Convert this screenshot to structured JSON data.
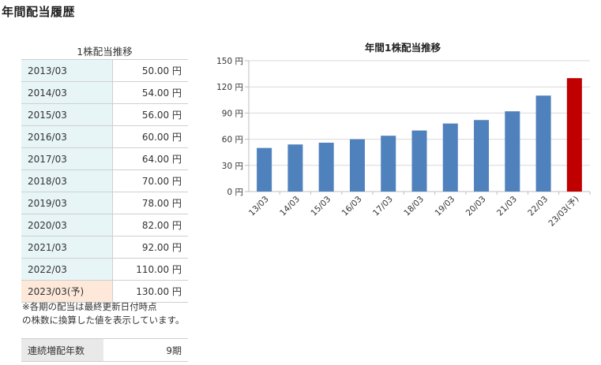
{
  "page": {
    "title": "年間配当履歴"
  },
  "history_table": {
    "caption": "1株配当推移",
    "rows": [
      {
        "period": "2013/03",
        "amount": "50.00 円"
      },
      {
        "period": "2014/03",
        "amount": "54.00 円"
      },
      {
        "period": "2015/03",
        "amount": "56.00 円"
      },
      {
        "period": "2016/03",
        "amount": "60.00 円"
      },
      {
        "period": "2017/03",
        "amount": "64.00 円"
      },
      {
        "period": "2018/03",
        "amount": "70.00 円"
      },
      {
        "period": "2019/03",
        "amount": "78.00 円"
      },
      {
        "period": "2020/03",
        "amount": "82.00 円"
      },
      {
        "period": "2021/03",
        "amount": "92.00 円"
      },
      {
        "period": "2022/03",
        "amount": "110.00 円"
      },
      {
        "period": "2023/03(予)",
        "amount": "130.00 円"
      }
    ],
    "forecast_highlight_color": "#fde8d9",
    "period_cell_color": "#e8f5f7"
  },
  "note": {
    "line1": "※各期の配当は最終更新日付時点",
    "line2": "の株数に換算した値を表示しています。"
  },
  "streak": {
    "label": "連続増配年数",
    "value": "9期"
  },
  "chart_data": {
    "type": "bar",
    "title": "年間1株配当推移",
    "categories": [
      "13/03",
      "14/03",
      "15/03",
      "16/03",
      "17/03",
      "18/03",
      "19/03",
      "20/03",
      "21/03",
      "22/03",
      "23/03(予)"
    ],
    "values": [
      50,
      54,
      56,
      60,
      64,
      70,
      78,
      82,
      92,
      110,
      130
    ],
    "y_ticks": [
      0,
      30,
      60,
      90,
      120,
      150
    ],
    "y_tick_unit": "円",
    "ylim": [
      0,
      150
    ],
    "grid": true,
    "colors": {
      "actual": "#4f81bd",
      "forecast": "#c00000",
      "grid": "#d9d9d9"
    },
    "forecast_index": 10
  }
}
